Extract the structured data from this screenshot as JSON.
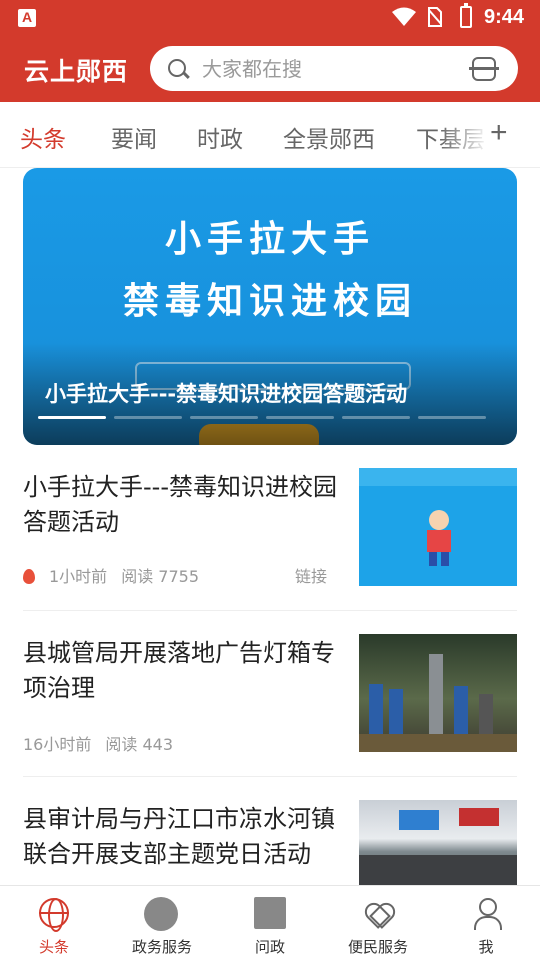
{
  "status_bar": {
    "time": "9:44",
    "icons": [
      "app-notification-icon",
      "wifi-icon",
      "no-sim-icon",
      "battery-charging-icon"
    ]
  },
  "header": {
    "app_title": "云上郧西",
    "search": {
      "placeholder": "大家都在搜",
      "icon": "search-icon",
      "scan_icon": "scan-icon"
    },
    "background_color": "#d33a2c"
  },
  "tabs": {
    "items": [
      {
        "label": "头条",
        "active": true
      },
      {
        "label": "要闻",
        "active": false
      },
      {
        "label": "时政",
        "active": false
      },
      {
        "label": "全景郧西",
        "active": false
      },
      {
        "label": "下基层",
        "active": false
      }
    ],
    "more_label": "+",
    "active_color": "#d33a2c"
  },
  "banner": {
    "image_text_line1": "小手拉大手",
    "image_text_line2": "禁毒知识进校园",
    "caption": "小手拉大手---禁毒知识进校园答题活动",
    "slide_count": 7,
    "active_slide": 1
  },
  "news": [
    {
      "title": "小手拉大手---禁毒知识进校园答题活动",
      "hot": true,
      "time": "1小时前",
      "reads": "阅读 7755",
      "source": "链接"
    },
    {
      "title": "县城管局开展落地广告灯箱专项治理",
      "hot": false,
      "time": "16小时前",
      "reads": "阅读 443",
      "source": ""
    },
    {
      "title": "县审计局与丹江口市凉水河镇联合开展支部主题党日活动",
      "hot": false,
      "time": "",
      "reads": "",
      "source": ""
    }
  ],
  "bottom_nav": [
    {
      "label": "头条",
      "icon": "globe-icon",
      "active": true
    },
    {
      "label": "政务服务",
      "icon": "gov-service-icon",
      "active": false
    },
    {
      "label": "问政",
      "icon": "inquiry-icon",
      "active": false
    },
    {
      "label": "便民服务",
      "icon": "heart-icon",
      "active": false
    },
    {
      "label": "我",
      "icon": "user-icon",
      "active": false
    }
  ]
}
